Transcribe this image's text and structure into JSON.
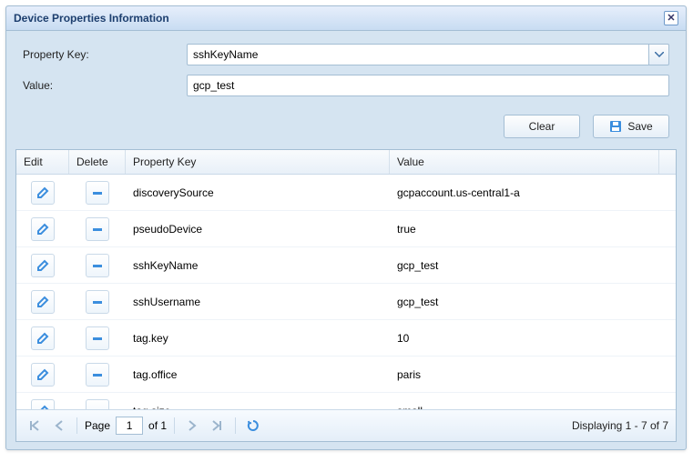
{
  "dialog": {
    "title": "Device Properties Information"
  },
  "form": {
    "property_key_label": "Property Key:",
    "property_key_value": "sshKeyName",
    "value_label": "Value:",
    "value_value": "gcp_test"
  },
  "buttons": {
    "clear": "Clear",
    "save": "Save"
  },
  "grid": {
    "columns": {
      "edit": "Edit",
      "delete": "Delete",
      "key": "Property Key",
      "value": "Value"
    },
    "rows": [
      {
        "key": "discoverySource",
        "value": "gcpaccount.us-central1-a"
      },
      {
        "key": "pseudoDevice",
        "value": "true"
      },
      {
        "key": "sshKeyName",
        "value": "gcp_test"
      },
      {
        "key": "sshUsername",
        "value": "gcp_test"
      },
      {
        "key": "tag.key",
        "value": "10"
      },
      {
        "key": "tag.office",
        "value": "paris"
      },
      {
        "key": "tag.size",
        "value": "small"
      }
    ]
  },
  "paging": {
    "page_label": "Page",
    "page_value": "1",
    "of_label": "of 1",
    "display": "Displaying 1 - 7 of 7"
  },
  "icons": {
    "close": "close-icon",
    "chevron_down": "chevron-down-icon",
    "save_disk": "save-disk-icon",
    "edit_pencil": "edit-pencil-icon",
    "delete_minus": "delete-minus-icon",
    "page_first": "page-first-icon",
    "page_prev": "page-prev-icon",
    "page_next": "page-next-icon",
    "page_last": "page-last-icon",
    "refresh": "refresh-icon"
  },
  "colors": {
    "accent": "#3b8ede",
    "header_text": "#1c3e6e",
    "border": "#a4bed4"
  }
}
